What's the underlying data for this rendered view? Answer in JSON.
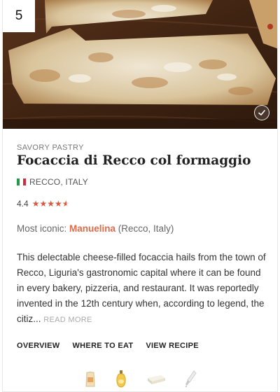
{
  "rank": "5",
  "category": "Savory pastry",
  "title": "Focaccia di Recco col formaggio",
  "origin": {
    "flag_colors": [
      "#1e9a48",
      "#ffffff",
      "#ce2b37"
    ],
    "label": "Recco, Italy"
  },
  "rating": {
    "value": "4.4",
    "stars": 4.4,
    "star_color": "#d9593e"
  },
  "iconic": {
    "prefix": "Most iconic: ",
    "place": "Manuelina",
    "location": " (Recco, Italy)"
  },
  "description": {
    "text": "This delectable cheese-filled focaccia hails from the town of Recco, Liguria's gastronomic capital where it can be found in every bakery, pizzeria, and restaurant. It was reportedly invented in the 12th century when, according to legend, the citiz...",
    "read_more": "READ MORE"
  },
  "tabs": [
    "OVERVIEW",
    "WHERE TO EAT",
    "VIEW RECIPE"
  ],
  "ingredients": [
    "flour-bag-icon",
    "olive-oil-bottle-icon",
    "cheese-block-icon",
    "salt-shaker-icon"
  ],
  "colors": {
    "accent": "#e06b4a",
    "hero_dark": "#4a2a17"
  }
}
